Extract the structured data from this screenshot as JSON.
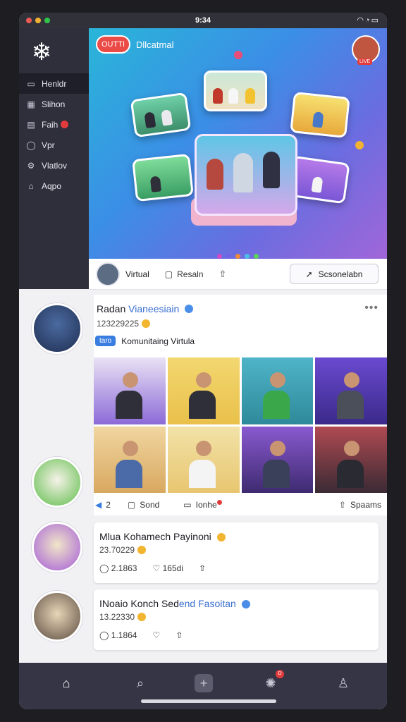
{
  "status_bar": {
    "time": "9:34",
    "system_icons": "wifi-icon signal-icon battery-icon"
  },
  "window_controls": {
    "colors": [
      "#ed5b55",
      "#f2b233",
      "#2fc54a"
    ]
  },
  "sidebar": {
    "logo_icon": "snowflake-icon",
    "items": [
      {
        "label": "Henldr",
        "icon": "home-icon",
        "active": true
      },
      {
        "label": "Slihon",
        "icon": "grid-icon"
      },
      {
        "label": "Faih",
        "icon": "message-icon",
        "badge": true
      },
      {
        "label": "Vpr",
        "icon": "profile-icon"
      },
      {
        "label": "Vlatlov",
        "icon": "settings-icon"
      },
      {
        "label": "Aqpo",
        "icon": "app-icon"
      }
    ]
  },
  "hero": {
    "tag": "OUTTI",
    "title": "Dllcatmal",
    "profile_badge": "LIVE",
    "pager_colors": [
      "#d04ac6",
      "#6f63e6",
      "#f08a3a",
      "#4ac0e8",
      "#5bd35b"
    ]
  },
  "action_bar": {
    "label": "Virtual",
    "comment_label": "Resaln",
    "button_label": "Scsonelabn"
  },
  "post": {
    "author_plain": "Radan",
    "author_highlight": "Vianeesiain",
    "meta": "123229225",
    "community_tag": "taro",
    "community_name": "Komunitaing Virtula",
    "actions": {
      "like_count": "2",
      "comment": "Sond",
      "reply": "Ionhe",
      "share": "Spaams"
    }
  },
  "mini_posts": [
    {
      "title_plain": "Mlua Kohamech Payinoni",
      "title_highlight": "",
      "meta": "23.70229",
      "likes": "2.1863",
      "comments": "165di"
    },
    {
      "title_plain": "INoaio Konch Sed",
      "title_highlight": "end Fasoitan",
      "meta": "13.22330",
      "likes": "1.1864",
      "comments": ""
    }
  ],
  "tab_bar": {
    "tabs": [
      "home-icon",
      "search-icon",
      "add-icon",
      "notifications-icon",
      "profile-icon"
    ],
    "notification_badge": "D"
  }
}
